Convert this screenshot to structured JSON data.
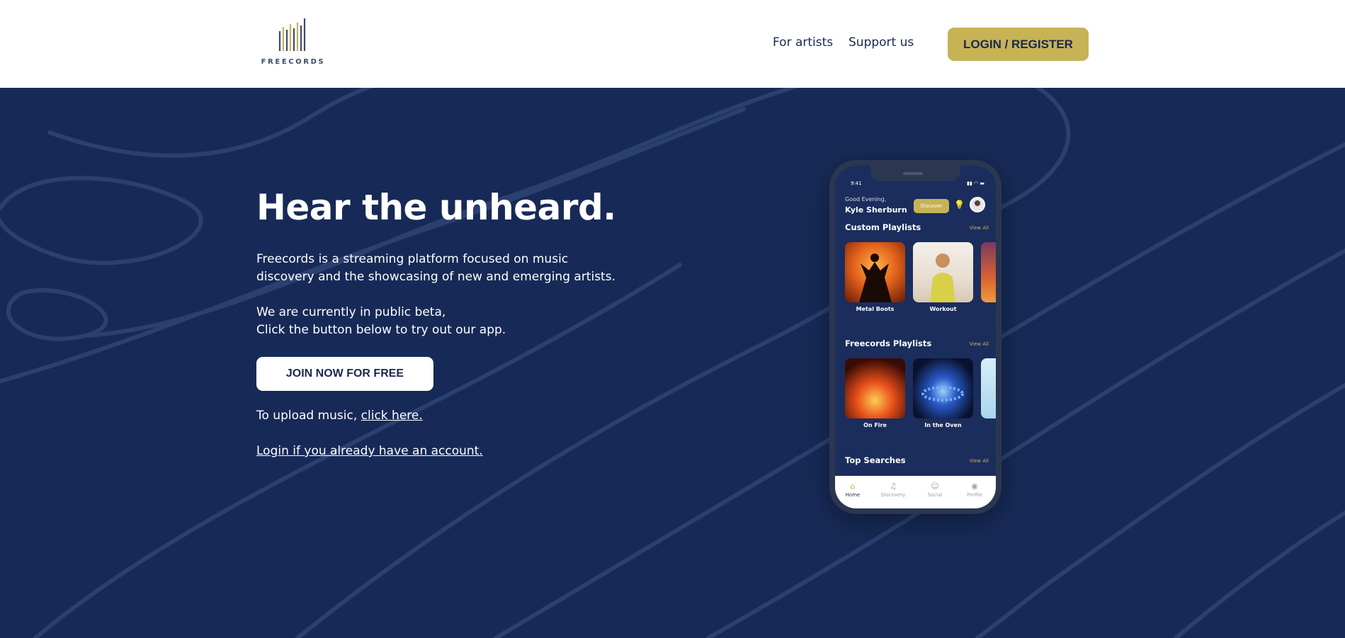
{
  "header": {
    "logo_text": "FREECORDS",
    "nav": [
      "For artists",
      "Support us"
    ],
    "login_label": "LOGIN / REGISTER"
  },
  "hero": {
    "title": "Hear the unheard.",
    "desc_line1": "Freecords is a streaming platform focused on music",
    "desc_line2": "discovery and the showcasing of new and emerging artists.",
    "beta_line1": "We are currently in public beta,",
    "beta_line2": "Click the button below to try out our app.",
    "join_label": "JOIN NOW FOR FREE",
    "upload_prefix": "To upload music, ",
    "upload_link": "click here.",
    "login_link": "Login if you already have an account."
  },
  "phone": {
    "time": "9:41",
    "greeting": "Good Evening,",
    "user_name": "Kyle Sherburn",
    "discover_label": "Discover",
    "section_custom": "Custom Playlists",
    "section_freecords": "Freecords Playlists",
    "section_top": "Top Searches",
    "view_all": "View All",
    "custom_playlists": [
      "Metal Boots",
      "Workout"
    ],
    "freecords_playlists": [
      "On Fire",
      "In the Oven"
    ],
    "tabs": [
      "Home",
      "Discovery",
      "Social",
      "Profile"
    ]
  },
  "colors": {
    "navy": "#172a57",
    "gold": "#c7b356",
    "white": "#ffffff"
  }
}
